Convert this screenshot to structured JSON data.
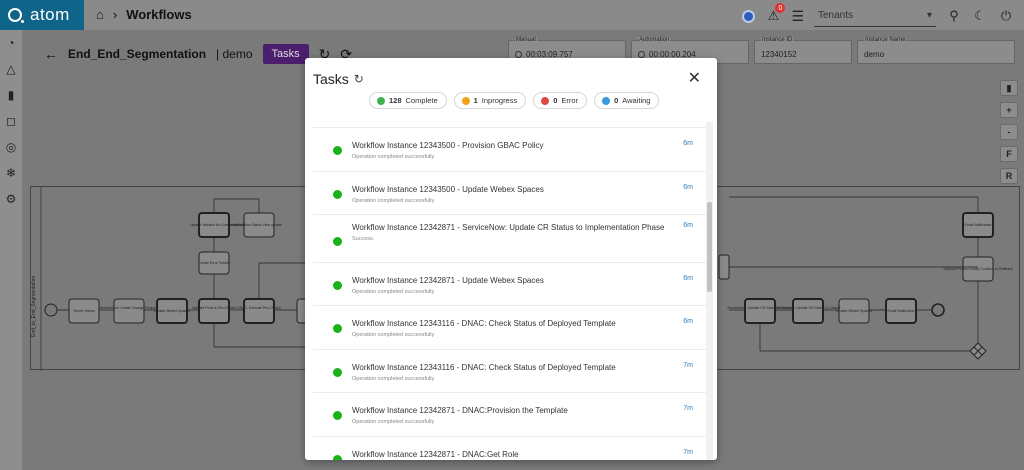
{
  "app": {
    "logo_text": "atom"
  },
  "breadcrumb": {
    "current": "Workflows"
  },
  "topbar": {
    "notification_count": "0",
    "tenant_placeholder": "Tenants"
  },
  "workflow": {
    "name": "End_End_Segmentation",
    "tenant": "| demo",
    "tasks_label": "Tasks"
  },
  "fields": {
    "manual": {
      "label": "Manual",
      "value": "00:03:09.757"
    },
    "automation": {
      "label": "Automation",
      "value": "00:00:00.204"
    },
    "instance_id": {
      "label": "Instance ID",
      "value": "12340152"
    },
    "instance_name": {
      "label": "Instance Name",
      "value": "demo"
    }
  },
  "tools": [
    "+",
    "-",
    "F",
    "R"
  ],
  "modal": {
    "title": "Tasks",
    "status_counts": [
      {
        "count": "128",
        "label": "Complete",
        "color": "#3fb24b"
      },
      {
        "count": "1",
        "label": "Inprogress",
        "color": "#f1a21a"
      },
      {
        "count": "0",
        "label": "Error",
        "color": "#e04848"
      },
      {
        "count": "0",
        "label": "Awaiting",
        "color": "#3a9bdc"
      }
    ],
    "tasks": [
      {
        "title": "Workflow Instance 12343500 - Provision GBAC Policy",
        "status": "Operation completed successfully",
        "time": "6m"
      },
      {
        "title": "Workflow Instance 12343500 - Update Webex Spaces",
        "status": "Operation completed successfully",
        "time": "6m"
      },
      {
        "title": "Workflow Instance 12342871 - ServiceNow: Update CR Status to Implementation Phase",
        "status": "Success.",
        "time": "6m"
      },
      {
        "title": "Workflow Instance 12342871 - Update Webex Spaces",
        "status": "Operation completed successfully",
        "time": "6m"
      },
      {
        "title": "Workflow Instance 12343116 - DNAC: Check Status of Deployed Template",
        "status": "Operation completed successfully",
        "time": "6m"
      },
      {
        "title": "Workflow Instance 12343116 - DNAC: Check Status of Deployed Template",
        "status": "Operation completed successfully",
        "time": "7m"
      },
      {
        "title": "Workflow Instance 12342871 - DNAC:Provision the Template",
        "status": "Operation completed successfully",
        "time": "7m"
      },
      {
        "title": "Workflow Instance 12342871 - DNAC:Get Role",
        "status": "",
        "time": "7m"
      }
    ]
  },
  "diagram": {
    "lane_label": "End_to_End_Segmentation",
    "nodes": [
      "Server Hands",
      "ServiceNow: Create Change Request",
      "Update Webex Spaces",
      "Validate Ports & Pre-Checks",
      "DNAC: Execute Pre-Checks",
      "Create Error Tickets",
      "Update Variable for Conformity",
      "Workflow Status View update",
      "ServiceNow: Update CR Status to Review",
      "ServiceNow: Update CR Status to Closed",
      "Update Webex Spaces",
      "Email Notification",
      "Email Notification",
      "Optional Point to Notify Continue to Rollback"
    ]
  }
}
